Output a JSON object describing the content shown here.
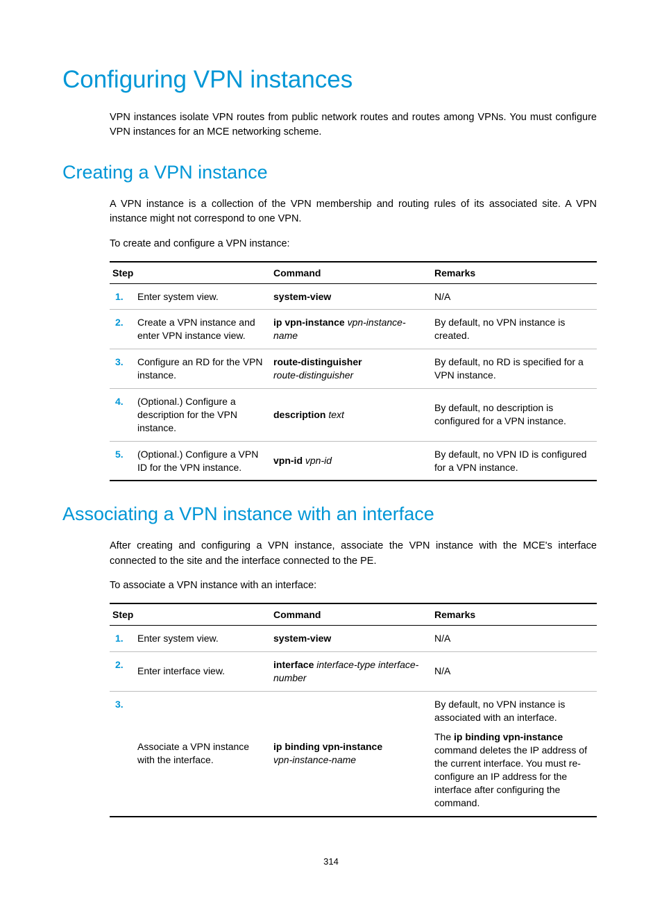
{
  "title": "Configuring VPN instances",
  "intro": "VPN instances isolate VPN routes from public network routes and routes among VPNs. You must configure VPN instances for an MCE networking scheme.",
  "section1": {
    "heading": "Creating a VPN instance",
    "p1": "A VPN instance is a collection of the VPN membership and routing rules of its associated site. A VPN instance might not correspond to one VPN.",
    "p2": "To create and configure a VPN instance:",
    "table": {
      "headers": {
        "step": "Step",
        "command": "Command",
        "remarks": "Remarks"
      },
      "rows": [
        {
          "num": "1.",
          "desc": "Enter system view.",
          "cmd_bold": "system-view",
          "cmd_italic": "",
          "remarks": "N/A"
        },
        {
          "num": "2.",
          "desc": "Create a VPN instance and enter VPN instance view.",
          "cmd_bold": "ip vpn-instance",
          "cmd_italic": " vpn-instance-name",
          "remarks": "By default, no VPN instance is created."
        },
        {
          "num": "3.",
          "desc": "Configure an RD for the VPN instance.",
          "cmd_bold": "route-distinguisher",
          "cmd_italic_br": "route-distinguisher",
          "remarks": "By default, no RD is specified for a VPN instance."
        },
        {
          "num": "4.",
          "desc": "(Optional.) Configure a description for the VPN instance.",
          "cmd_bold": "description",
          "cmd_italic": " text",
          "remarks": "By default, no description is configured for a VPN instance."
        },
        {
          "num": "5.",
          "desc": "(Optional.) Configure a VPN ID for the VPN instance.",
          "cmd_bold": "vpn-id",
          "cmd_italic": " vpn-id",
          "remarks": "By default, no VPN ID is configured for a VPN instance."
        }
      ]
    }
  },
  "section2": {
    "heading": "Associating a VPN instance with an interface",
    "p1": "After creating and configuring a VPN instance, associate the VPN instance with the MCE's interface connected to the site and the interface connected to the PE.",
    "p2": "To associate a VPN instance with an interface:",
    "table": {
      "headers": {
        "step": "Step",
        "command": "Command",
        "remarks": "Remarks"
      },
      "rows": [
        {
          "num": "1.",
          "desc": "Enter system view.",
          "cmd_bold": "system-view",
          "remarks": "N/A"
        },
        {
          "num": "2.",
          "desc": "Enter interface view.",
          "cmd_bold": "interface",
          "cmd_italic": " interface-type interface-number",
          "remarks": "N/A"
        },
        {
          "num": "3.",
          "desc": "Associate a VPN instance with the interface.",
          "cmd_bold": "ip binding vpn-instance",
          "cmd_italic_br": "vpn-instance-name",
          "remarks_p1": "By default, no VPN instance is associated with an interface.",
          "remarks_p2_pre": "The ",
          "remarks_p2_bold": "ip binding vpn-instance",
          "remarks_p2_post": " command deletes the IP address of the current interface. You must re-configure an IP address for the interface after configuring the command."
        }
      ]
    }
  },
  "page_number": "314"
}
